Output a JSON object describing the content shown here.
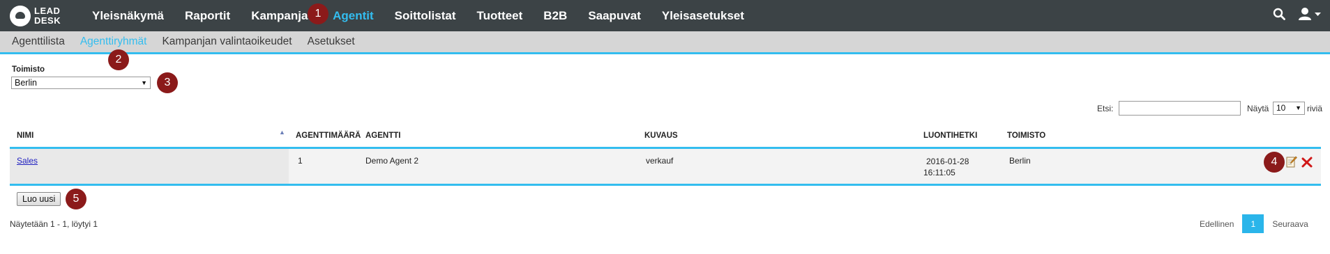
{
  "logo": {
    "line1": "LEAD",
    "line2": "DESK"
  },
  "nav": {
    "items": [
      {
        "label": "Yleisnäkymä"
      },
      {
        "label": "Raportit"
      },
      {
        "label": "Kampanjat"
      },
      {
        "label": "Agentit"
      },
      {
        "label": "Soittolistat"
      },
      {
        "label": "Tuotteet"
      },
      {
        "label": "B2B"
      },
      {
        "label": "Saapuvat"
      },
      {
        "label": "Yleisasetukset"
      }
    ],
    "active": "Agentit"
  },
  "subnav": {
    "items": [
      {
        "label": "Agenttilista"
      },
      {
        "label": "Agenttiryhmät"
      },
      {
        "label": "Kampanjan valintaoikeudet"
      },
      {
        "label": "Asetukset"
      }
    ],
    "active": "Agenttiryhmät"
  },
  "markers": [
    "1",
    "2",
    "3",
    "4",
    "5"
  ],
  "filter": {
    "label": "Toimisto",
    "value": "Berlin"
  },
  "search": {
    "label": "Etsi:",
    "value": ""
  },
  "length": {
    "label": "Näytä",
    "value": "10",
    "suffix": "riviä"
  },
  "table": {
    "headers": [
      "NIMI",
      "AGENTTIMÄÄRÄ",
      "AGENTTI",
      "KUVAUS",
      "LUONTIHETKI",
      "TOIMISTO"
    ],
    "rows": [
      {
        "name": "Sales",
        "count": "1",
        "agent": "Demo Agent 2",
        "description": "verkauf",
        "created_date": "2016-01-28",
        "created_time": "16:11:05",
        "office": "Berlin"
      }
    ]
  },
  "buttons": {
    "new": "Luo uusi"
  },
  "info": "Näytetään 1 - 1, löytyi 1",
  "pagination": {
    "prev": "Edellinen",
    "current": "1",
    "next": "Seuraava"
  },
  "colors": {
    "topbar": "#3c4346",
    "accent": "#33bdef",
    "marker": "#8b1a1a",
    "subbar": "#d6d6d6"
  }
}
